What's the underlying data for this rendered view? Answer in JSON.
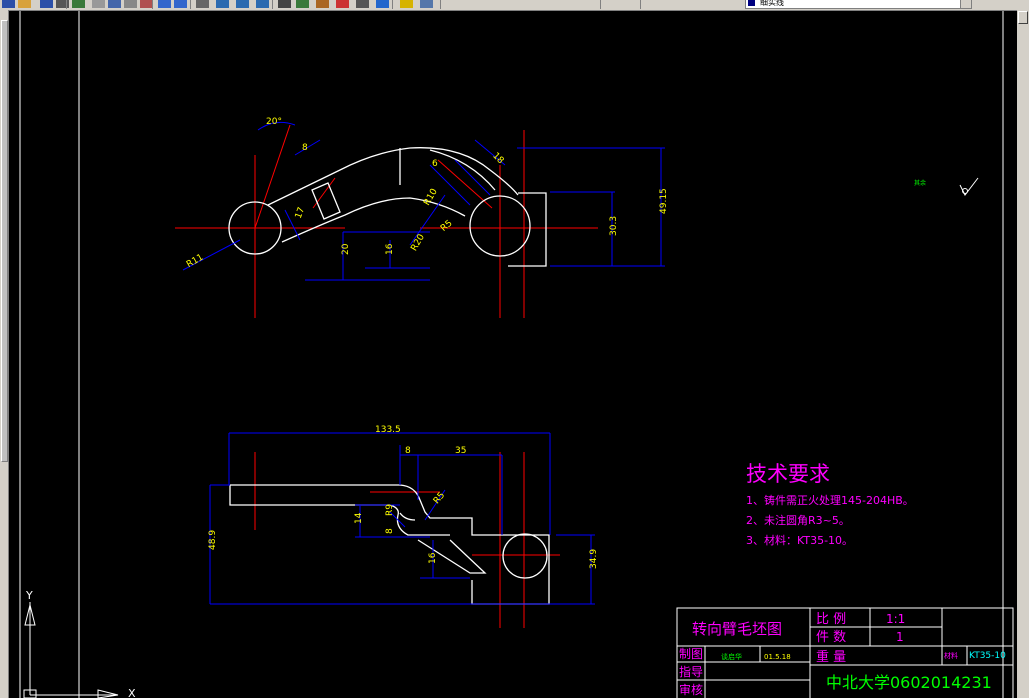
{
  "toolbar": {
    "layer_value": "细实线",
    "icons": [
      "new-icon",
      "open-icon",
      "save-icon",
      "print-icon",
      "preview-icon",
      "cut-icon",
      "copy-icon",
      "paste-icon",
      "match-icon",
      "undo-icon",
      "redo-icon",
      "pan-icon",
      "zoom-icon",
      "zoom-window-icon",
      "zoom-prev-icon",
      "properties-icon",
      "design-center-icon",
      "tool-palette-icon",
      "markup-icon",
      "calc-icon",
      "help-icon",
      "layer-icon",
      "layer-state-icon"
    ]
  },
  "colors": {
    "background": "#000000",
    "outline": "#ffffff",
    "dimension": "#0000ff",
    "dimension_text": "#ffff00",
    "centerline": "#ff0000",
    "notes": "#ff00ff",
    "frame": "#ffffff",
    "title_text": "#ff00ff",
    "green_text": "#00ff00",
    "cyan_text": "#00ffff"
  },
  "drawing": {
    "top_view_dims": {
      "angle": "20°",
      "d8": "8",
      "d17": "17",
      "r11": "R11",
      "d20": "20",
      "d16": "16",
      "r20": "R20",
      "r10": "R10",
      "d6": "6",
      "r5": "R5",
      "d18": "18",
      "d30_3": "30.3",
      "d49_15": "49.15"
    },
    "front_view_dims": {
      "d133_5": "133.5",
      "d8": "8",
      "d35": "35",
      "r5": "R5",
      "r9": "R9",
      "d14": "14",
      "d8b": "8",
      "d48_9": "48.9",
      "d16": "16",
      "d34_9": "34.9"
    },
    "roughness_label": "其余",
    "ucs": {
      "y": "Y",
      "x": "X"
    }
  },
  "notes": {
    "title": "技术要求",
    "items": [
      "1、铸件需正火处理145-204HB。",
      "2、未注圆角R3~5。",
      "3、材料：KT35-10。"
    ]
  },
  "title_block": {
    "part_name": "转向臂毛坯图",
    "scale_label": "比 例",
    "scale_value": "1:1",
    "qty_label": "件 数",
    "qty_value": "1",
    "weight_label": "重 量",
    "drawn_label": "制图",
    "drawn_name": "谈启华",
    "drawn_date": "01.5.18",
    "guide_label": "指导",
    "check_label": "审核",
    "material_label": "材料",
    "material_value": "KT35-10",
    "school": "中北大学0602014231"
  }
}
